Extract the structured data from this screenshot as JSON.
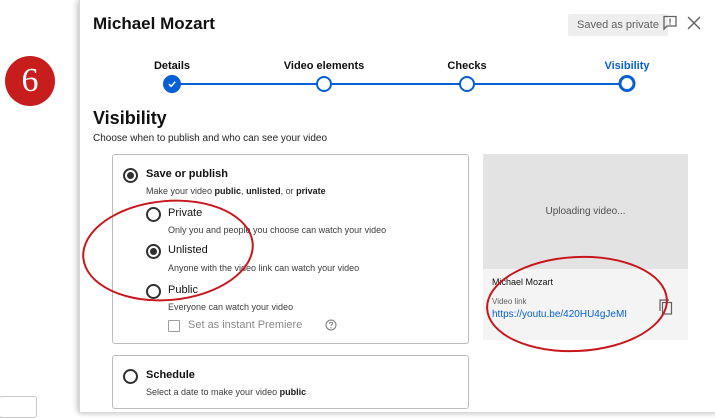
{
  "step_badge": {
    "number": "6"
  },
  "dialog": {
    "title": "Michael Mozart",
    "saved_badge": "Saved as private",
    "feedback_icon": "feedback-icon",
    "close_icon": "close-icon"
  },
  "stepper": {
    "steps": [
      {
        "label": "Details",
        "state": "done"
      },
      {
        "label": "Video elements",
        "state": "complete"
      },
      {
        "label": "Checks",
        "state": "complete"
      },
      {
        "label": "Visibility",
        "state": "current"
      }
    ],
    "accent_color": "#065fd4"
  },
  "visibility": {
    "title": "Visibility",
    "subtitle": "Choose when to publish and who can see your video",
    "save_or_publish": {
      "title": "Save or publish",
      "desc_pre": "Make your video ",
      "desc_public": "public",
      "desc_sep": ", ",
      "desc_unlisted": "unlisted",
      "desc_or": ", or ",
      "desc_private": "private",
      "selected": true
    },
    "options": [
      {
        "label": "Private",
        "desc": "Only you and people you choose can watch your video",
        "selected": false
      },
      {
        "label": "Unlisted",
        "desc": "Anyone with the video link can watch your video",
        "selected": true
      },
      {
        "label": "Public",
        "desc": "Everyone can watch your video",
        "selected": false
      }
    ],
    "premiere": {
      "label": "Set as instant Premiere",
      "checked": false,
      "help_icon": "help-icon"
    },
    "schedule": {
      "title": "Schedule",
      "desc_pre": "Select a date to make your video ",
      "desc_bold": "public",
      "selected": false
    }
  },
  "preview": {
    "status": "Uploading video...",
    "video_name": "Michael Mozart",
    "link_label": "Video link",
    "link": "https://youtu.be/420HU4gJeMI",
    "copy_icon": "copy-icon"
  },
  "annotation_color": "#c8161d"
}
